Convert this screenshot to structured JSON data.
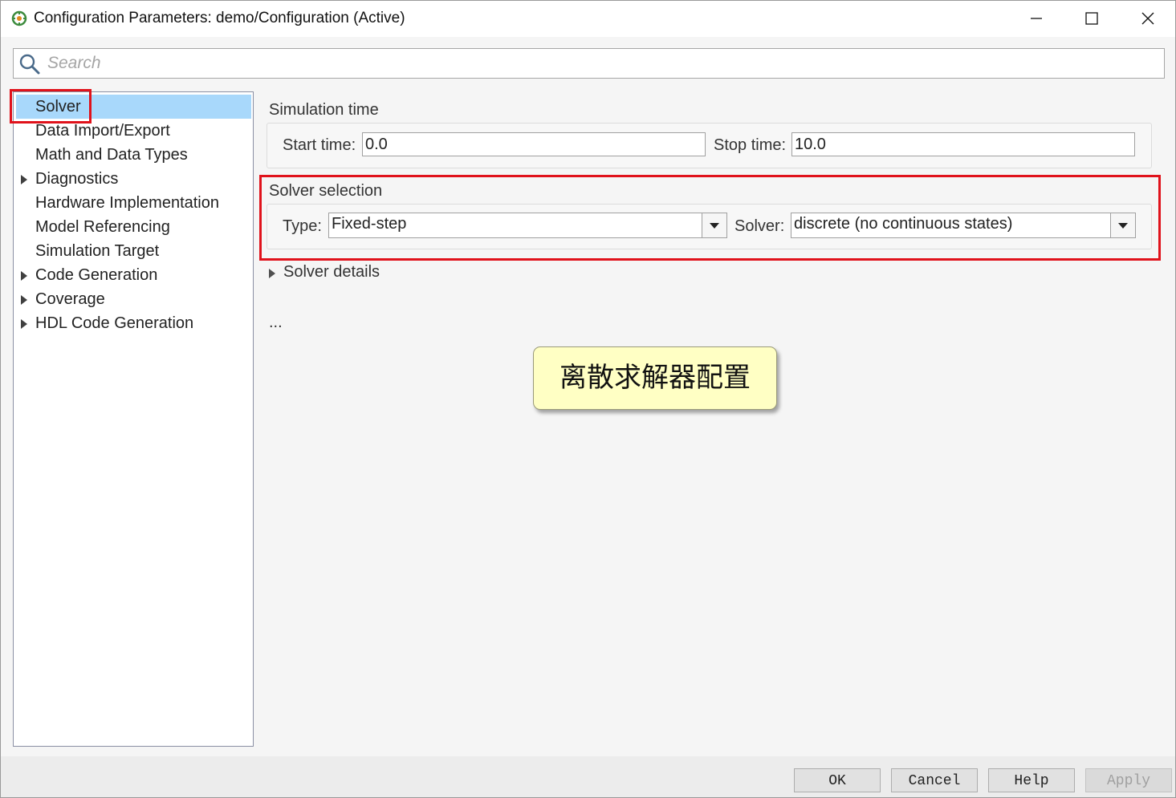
{
  "window": {
    "title": "Configuration Parameters: demo/Configuration (Active)",
    "controls": [
      "minimize-icon",
      "maximize-icon",
      "close-icon"
    ]
  },
  "search": {
    "placeholder": "Search",
    "value": ""
  },
  "sidebar": {
    "items": [
      {
        "label": "Solver",
        "expandable": false,
        "selected": true
      },
      {
        "label": "Data Import/Export",
        "expandable": false
      },
      {
        "label": "Math and Data Types",
        "expandable": false
      },
      {
        "label": "Diagnostics",
        "expandable": true
      },
      {
        "label": "Hardware Implementation",
        "expandable": false
      },
      {
        "label": "Model Referencing",
        "expandable": false
      },
      {
        "label": "Simulation Target",
        "expandable": false
      },
      {
        "label": "Code Generation",
        "expandable": true
      },
      {
        "label": "Coverage",
        "expandable": true
      },
      {
        "label": "HDL Code Generation",
        "expandable": true
      }
    ]
  },
  "simulation_time": {
    "title": "Simulation time",
    "start_label": "Start time:",
    "start_value": "0.0",
    "stop_label": "Stop time:",
    "stop_value": "10.0"
  },
  "solver_selection": {
    "title": "Solver selection",
    "type_label": "Type:",
    "type_value": "Fixed-step",
    "solver_label": "Solver:",
    "solver_value": "discrete (no continuous states)"
  },
  "solver_details": {
    "label": "Solver details"
  },
  "ellipsis": "...",
  "annotation": {
    "text": "离散求解器配置"
  },
  "buttons": {
    "ok": "OK",
    "cancel": "Cancel",
    "help": "Help",
    "apply": "Apply"
  },
  "colors": {
    "selection": "#a8d8fb",
    "highlight_box": "#e0121b",
    "callout_bg": "#ffffc4"
  }
}
